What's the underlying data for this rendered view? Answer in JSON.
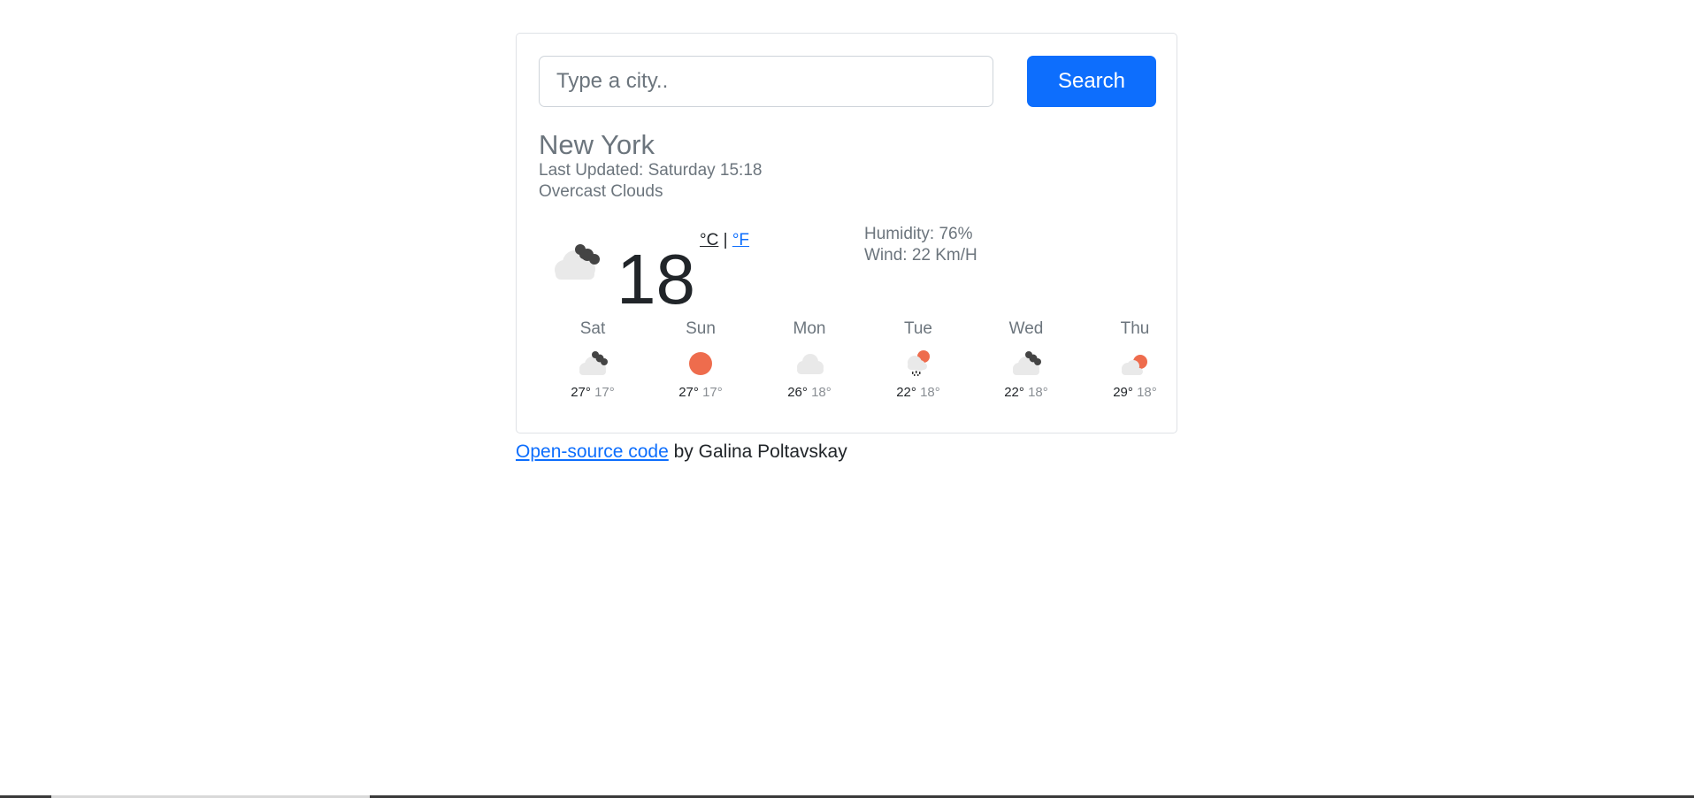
{
  "search": {
    "placeholder": "Type a city..",
    "value": "",
    "button_label": "Search"
  },
  "current": {
    "city": "New York",
    "last_updated": "Last Updated: Saturday 15:18",
    "description": "Overcast Clouds",
    "icon": "broken-clouds-icon",
    "temperature": "18",
    "unit_celsius": "°C",
    "unit_separator": "|",
    "unit_fahrenheit": "°F",
    "humidity": "Humidity: 76%",
    "wind": "Wind: 22 Km/H"
  },
  "forecast": [
    {
      "day": "Sat",
      "icon": "broken-clouds-icon",
      "max": "27°",
      "min": "17°"
    },
    {
      "day": "Sun",
      "icon": "clear-sun-icon",
      "max": "27°",
      "min": "17°"
    },
    {
      "day": "Mon",
      "icon": "cloud-icon",
      "max": "26°",
      "min": "18°"
    },
    {
      "day": "Tue",
      "icon": "rain-sun-icon",
      "max": "22°",
      "min": "18°"
    },
    {
      "day": "Wed",
      "icon": "broken-clouds-icon",
      "max": "22°",
      "min": "18°"
    },
    {
      "day": "Thu",
      "icon": "partly-cloudy-icon",
      "max": "29°",
      "min": "18°"
    }
  ],
  "footer": {
    "link_text": "Open-source code",
    "suffix": "by Galina Poltavskay"
  },
  "colors": {
    "accent": "#0d6efd",
    "sun": "#ee6c4d",
    "cloud_light": "#e9e9e9",
    "cloud_dark": "#444444",
    "muted_text": "#6c757d"
  }
}
